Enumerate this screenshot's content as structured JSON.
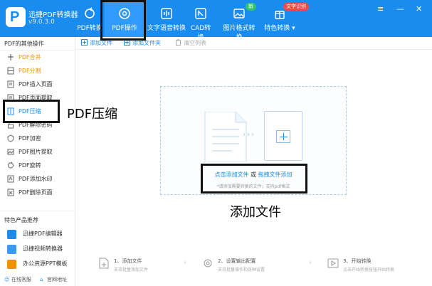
{
  "app": {
    "title": "迅捷PDF转换器",
    "version": "v9.0.3.0"
  },
  "nav": {
    "items": [
      {
        "label": "PDF转换"
      },
      {
        "label": "PDF操作"
      },
      {
        "label": "文字语音转换"
      },
      {
        "label": "CAD转换"
      },
      {
        "label": "图片格式转换"
      },
      {
        "label": "特色转换 ▾"
      }
    ],
    "badge_new": "新",
    "badge_ocr": "文字识别"
  },
  "sidebar": {
    "section_title": "PDF的其他操作",
    "items": [
      {
        "label": "PDF合并"
      },
      {
        "label": "PDF分割"
      },
      {
        "label": "PDF插入页面"
      },
      {
        "label": "PDF页面提取"
      },
      {
        "label": "PDF压缩"
      },
      {
        "label": "PDF解除密码"
      },
      {
        "label": "PDF加密"
      },
      {
        "label": "PDF图片提取"
      },
      {
        "label": "PDF旋转"
      },
      {
        "label": "PDF添加水印"
      },
      {
        "label": "PDF删除页面"
      }
    ],
    "rec_title": "特色产品推荐",
    "rec_items": [
      {
        "label": "迅捷PDF编辑器"
      },
      {
        "label": "迅捷视频转换器"
      },
      {
        "label": "办公资源PPT模板"
      }
    ],
    "footer_service": "在线客服",
    "footer_site": "官网地址"
  },
  "toolbar": {
    "add_file": "添加文件",
    "add_folder": "添加文件夹",
    "clear_list": "清空列表"
  },
  "dropzone": {
    "click_add": "点击添加文件",
    "or": " 或 ",
    "drag_add": "拖拽文件添加",
    "hint": "*请添加需要转换的文件，支持pdf格式"
  },
  "steps": [
    {
      "title": "1、添加文件",
      "desc": "支持批量添加文件"
    },
    {
      "title": "2、设置输出配置",
      "desc": "支持批量操作和各种设置"
    },
    {
      "title": "3、开始转换",
      "desc": "点击开始转换按钮开始转换"
    }
  ],
  "annotations": {
    "compress_label": "PDF压缩",
    "add_file_label": "添加文件"
  },
  "colors": {
    "brand": "#1a8cf0",
    "accent_orange": "#f39200"
  }
}
